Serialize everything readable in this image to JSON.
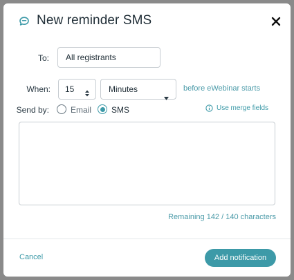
{
  "modal": {
    "title": "New reminder SMS",
    "title_icon": "chat-bubble-icon",
    "close_icon": "close-icon"
  },
  "form": {
    "to_label": "To:",
    "to_value": "All registrants",
    "when_label": "When:",
    "when_number": "15",
    "when_unit": "Minutes",
    "when_suffix": "before eWebinar starts",
    "send_by_label": "Send by:",
    "send_options": [
      {
        "label": "Email",
        "selected": false
      },
      {
        "label": "SMS",
        "selected": true
      }
    ],
    "merge_fields_link": "Use merge fields",
    "message_value": "",
    "remaining_text": "Remaining 142 / 140 characters"
  },
  "footer": {
    "cancel_label": "Cancel",
    "submit_label": "Add notification"
  },
  "colors": {
    "accent": "#3d9aa8",
    "overlay": "#8a8a8a"
  }
}
